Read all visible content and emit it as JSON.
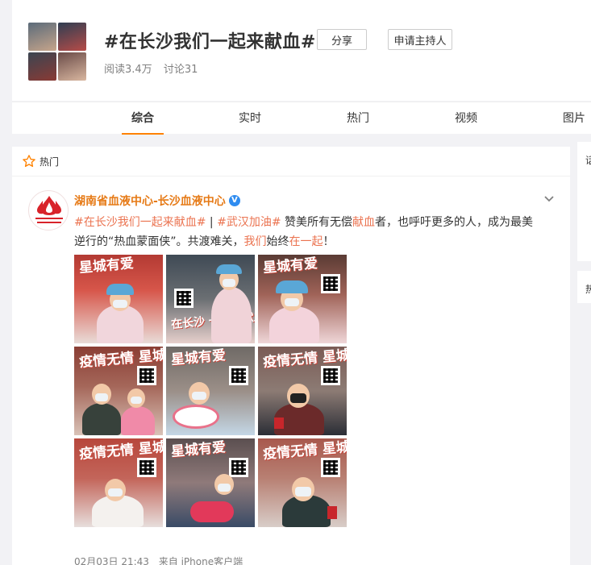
{
  "topic": {
    "title": "#在长沙我们一起来献血#",
    "share_label": "分享",
    "apply_host_label": "申请主持人",
    "reads": "阅读3.4万",
    "discussions": "讨论31"
  },
  "tabs": [
    "综合",
    "实时",
    "热门",
    "视频",
    "图片"
  ],
  "active_tab": "综合",
  "feed": {
    "section_label": "热门",
    "post": {
      "author": "湖南省血液中心-长沙血液中心",
      "verified": "V",
      "text_parts": {
        "tag1": "#在长沙我们一起来献血#",
        "sep": " | ",
        "tag2": "#武汉加油#",
        "t1": " 赞美所有无偿",
        "h1": "献血",
        "t2": "者，也呼吁更多的人，成为最美逆行的“热血蒙面侠”。共渡难关，",
        "h2": "我们",
        "t3": "始终",
        "h3": "在一起",
        "t4": "！"
      },
      "photo_captions": [
        "星城有爱",
        "在长沙 一起来献血",
        "星城有爱",
        "疫情无情 星城有爱",
        "星城有爱",
        "疫情无情 星城有爱",
        "疫情无情 星城有爱",
        "星城有爱",
        "疫情无情 星城有爱"
      ],
      "date": "02月03日 21:43",
      "source": "来自 iPhone客户端"
    }
  },
  "side": {
    "card1_label": "话",
    "card2_label": "热"
  },
  "colors": {
    "accent": "#ff8200",
    "tag": "#eb7350",
    "author": "#e67a16",
    "muted": "#808080"
  }
}
